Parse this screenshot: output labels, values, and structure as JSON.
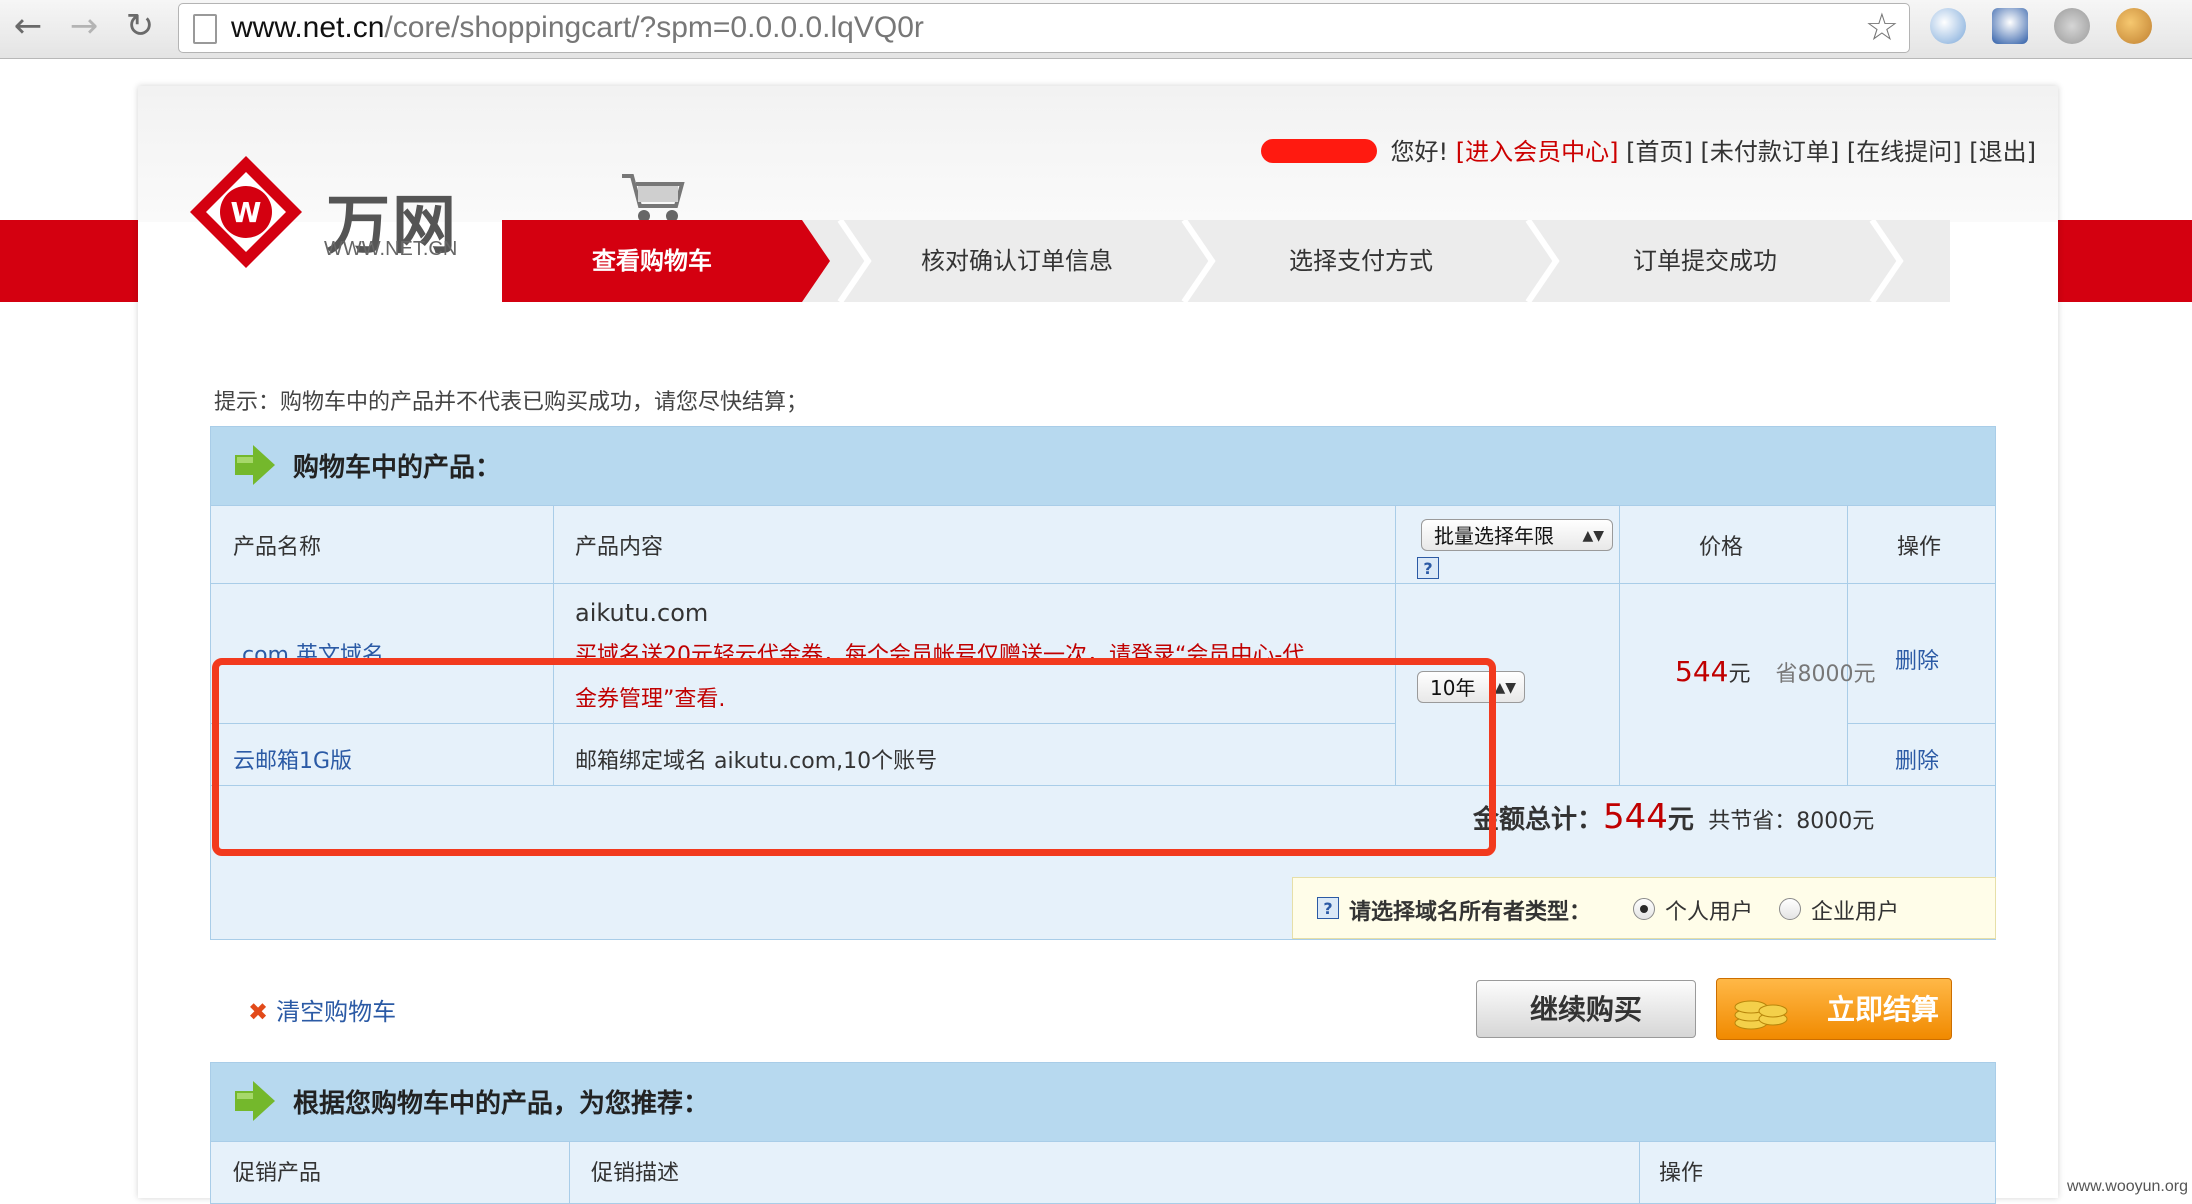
{
  "browser": {
    "url_host": "www.net.cn",
    "url_path": "/core/shoppingcart/?spm=0.0.0.0.lqVQ0r"
  },
  "brand": {
    "logo_text": "万网",
    "logo_sub": "WWW.NET.CN"
  },
  "topbar": {
    "greeting": "您好!",
    "links": [
      "[进入会员中心]",
      "[首页]",
      "[未付款订单]",
      "[在线提问]",
      "[退出]"
    ]
  },
  "steps": [
    "查看购物车",
    "核对确认订单信息",
    "选择支付方式",
    "订单提交成功"
  ],
  "tip": "提示：购物车中的产品并不代表已购买成功，请您尽快结算；",
  "cart": {
    "title": "购物车中的产品：",
    "headers": {
      "name": "产品名称",
      "content": "产品内容",
      "batch_select": "批量选择年限",
      "price": "价格",
      "action": "操作"
    },
    "rows": [
      {
        "name": ".com 英文域名",
        "content_line1": "aikutu.com",
        "content_note1": "买域名送20元轻云代金券，每个会员帐号仅赠送一次，请登录“会员中心-代",
        "content_note2": "金券管理”查看.",
        "term": "10年",
        "action": "删除"
      },
      {
        "name": "云邮箱1G版",
        "content_line1": "邮箱绑定域名 aikutu.com,10个账号",
        "action": "删除"
      }
    ],
    "price": {
      "amount": "544",
      "unit": "元",
      "save": "省8000元"
    },
    "total": {
      "label": "金额总计：",
      "amount": "544",
      "unit": "元",
      "save_label": "共节省：",
      "save_value": "8000元"
    }
  },
  "owner_type": {
    "label": "请选择域名所有者类型：",
    "options": [
      "个人用户",
      "企业用户"
    ],
    "selected": "个人用户"
  },
  "actions": {
    "clear": "清空购物车",
    "continue": "继续购买",
    "checkout": "立即结算"
  },
  "recommend": {
    "title": "根据您购物车中的产品，为您推荐：",
    "headers": [
      "促销产品",
      "促销描述",
      "操作"
    ]
  },
  "watermark": "www.wooyun.org",
  "colors": {
    "brand_red": "#d40010",
    "link_blue": "#2b5aa5",
    "header_blue": "#b7d9ef",
    "highlight_red": "#f23a1e",
    "price_red": "#c00000"
  }
}
